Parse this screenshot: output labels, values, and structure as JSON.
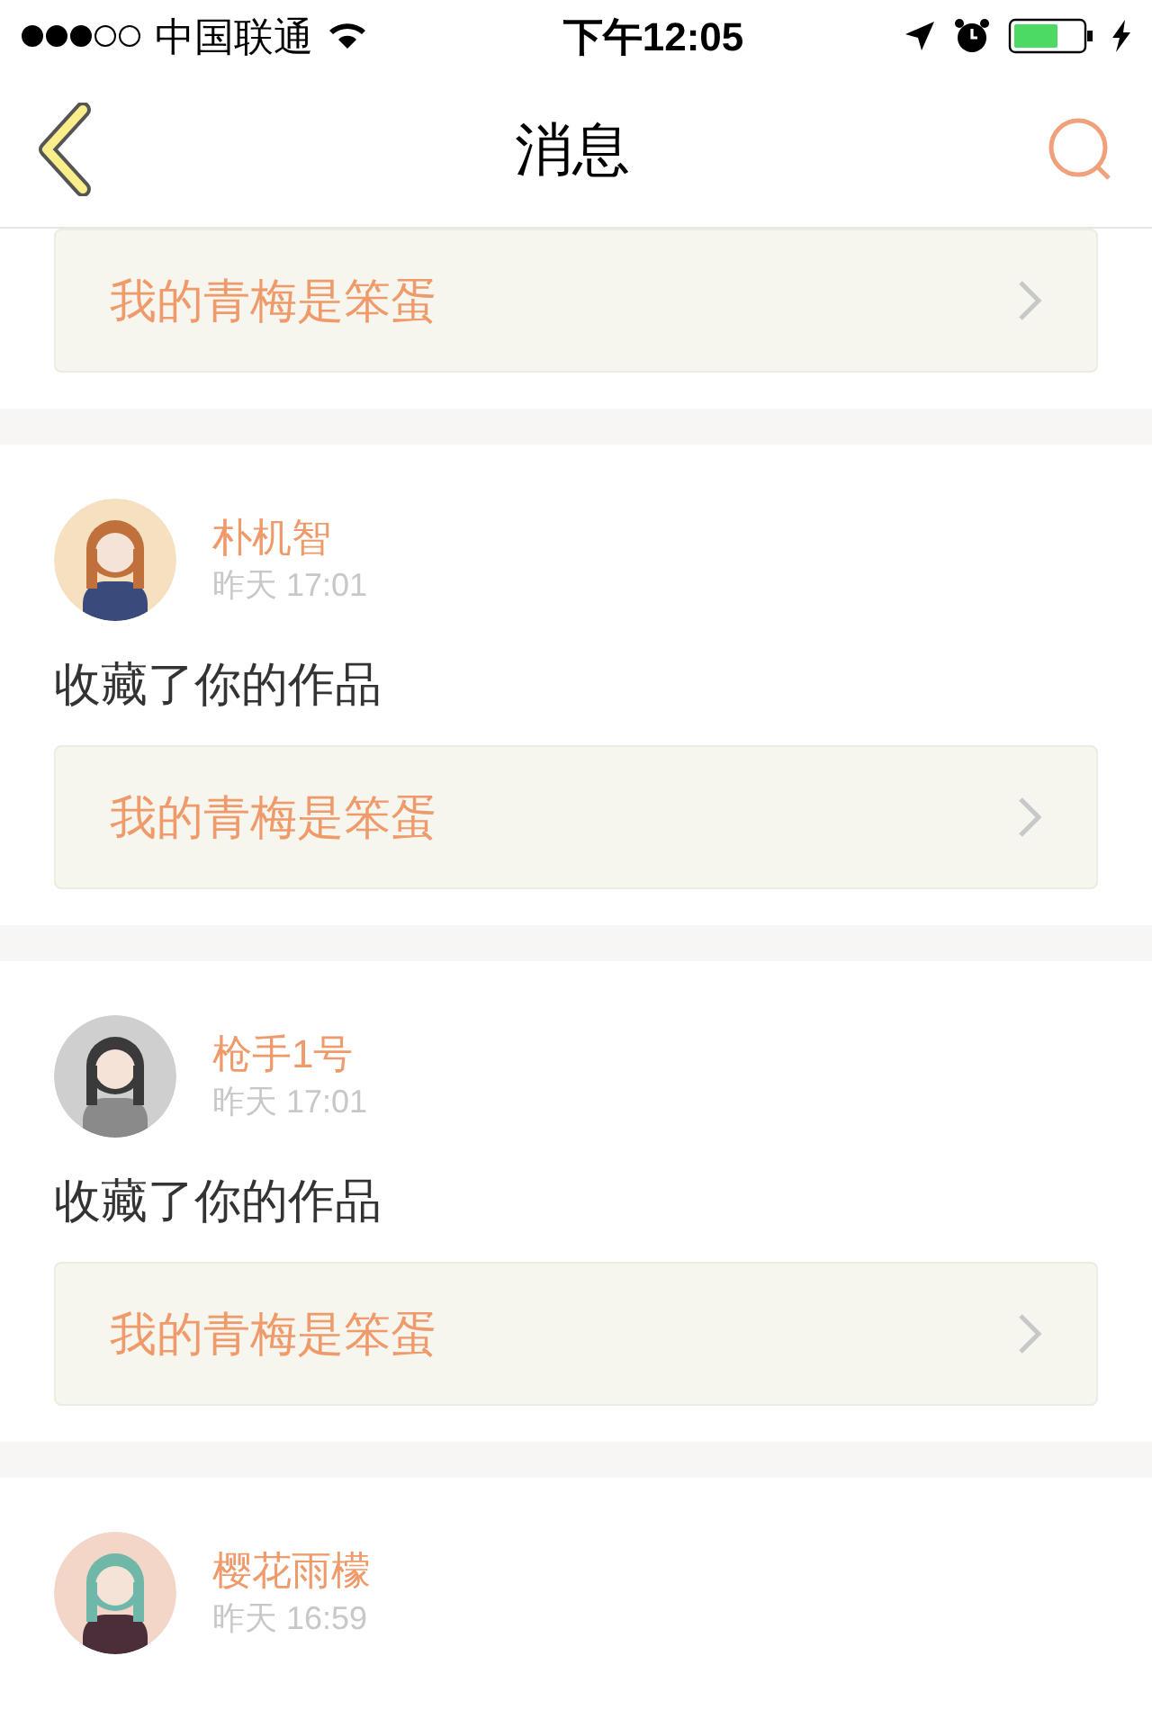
{
  "status_bar": {
    "carrier": "中国联通",
    "time": "下午12:05"
  },
  "nav": {
    "title": "消息"
  },
  "messages": [
    {
      "work_title": "我的青梅是笨蛋"
    },
    {
      "name": "朴机智",
      "time": "昨天 17:01",
      "action": "收藏了你的作品",
      "work_title": "我的青梅是笨蛋"
    },
    {
      "name": "枪手1号",
      "time": "昨天 17:01",
      "action": "收藏了你的作品",
      "work_title": "我的青梅是笨蛋"
    },
    {
      "name": "樱花雨檬",
      "time": "昨天 16:59"
    }
  ]
}
